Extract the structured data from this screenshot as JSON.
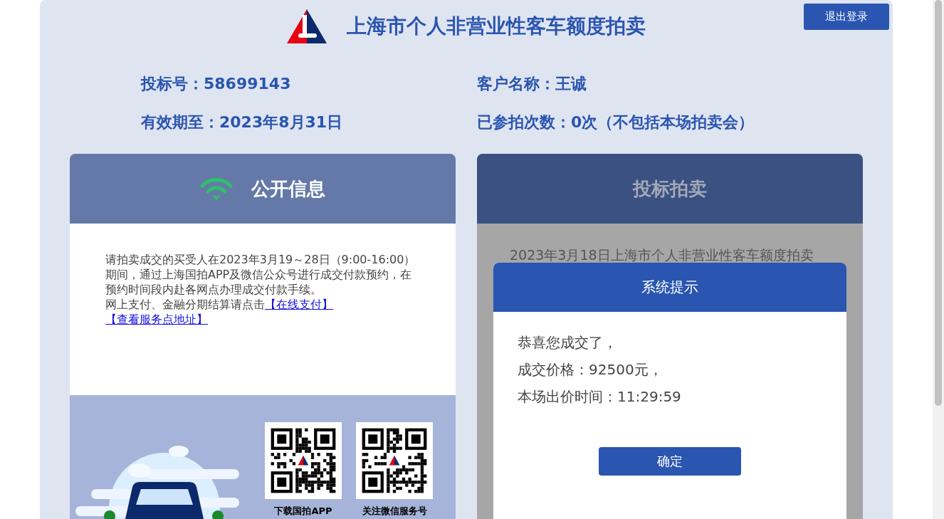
{
  "header": {
    "title": "上海市个人非营业性客车额度拍卖",
    "logout_button": "退出登录"
  },
  "info": [
    "投标号：58699143",
    "客户名称：王诚",
    "有效期至：2023年8月31日",
    "已参拍次数：0次（不包括本场拍卖会）"
  ],
  "public_info": {
    "title": "公开信息",
    "paragraph": "请拍卖成交的买受人在2023年3月19～28日（9:00-16:00）期间，通过上海国拍APP及微信公众号进行成交付款预约，在预约时间段内赴各网点办理成交付款手续。",
    "payment_note": "网上支付、金融分期结算请点击",
    "links": [
      "【在线支付】",
      "【查看服务点地址】"
    ],
    "qr_codes": [
      {
        "caption": "下载国拍APP"
      },
      {
        "caption": "关注微信服务号"
      }
    ]
  },
  "bidding": {
    "title": "投标拍卖",
    "notice": "2023年3月18日上海市个人非营业性客车额度拍卖"
  },
  "dialog": {
    "title": "系统提示",
    "lines": [
      "恭喜您成交了，",
      "成交价格：92500元，",
      "本场出价时间：11:29:59"
    ],
    "confirm_button": "确定"
  }
}
